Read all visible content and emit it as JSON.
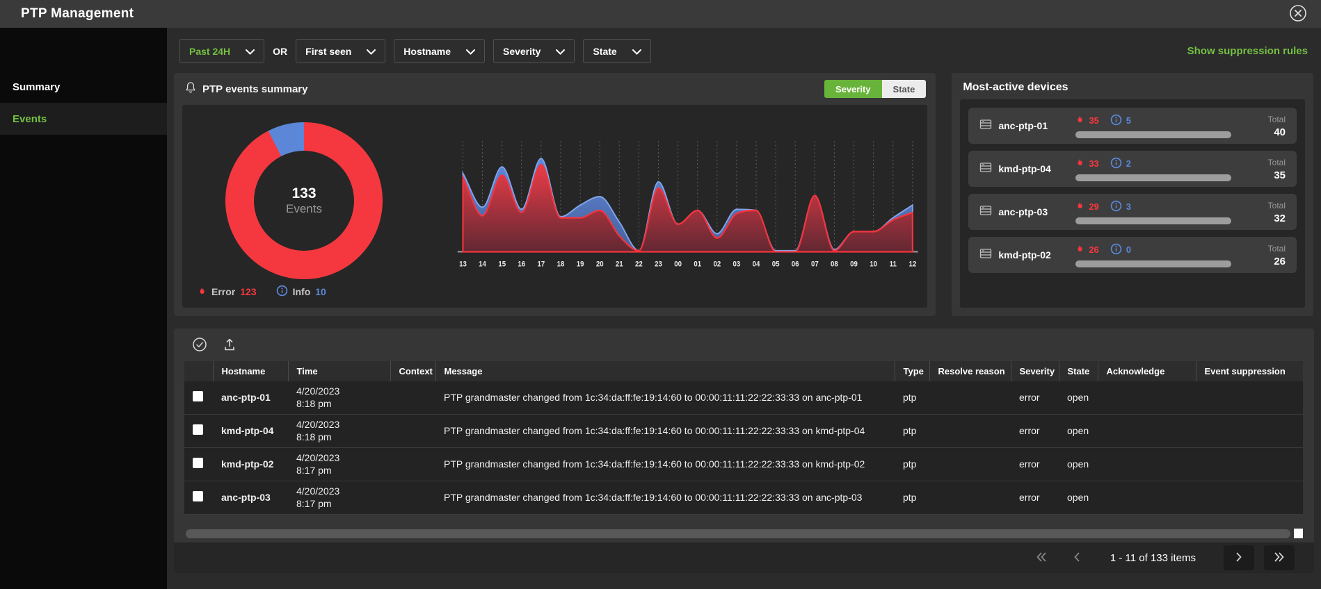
{
  "colors": {
    "accent_green": "#74c043",
    "error_red": "#f5383f",
    "info_blue": "#5c87d8",
    "device_bar_gray": "#9d9d9d"
  },
  "window": {
    "title": "PTP Management"
  },
  "sidebar": {
    "items": [
      {
        "label": "Summary",
        "active": false
      },
      {
        "label": "Events",
        "active": true
      }
    ]
  },
  "filter_bar": {
    "time_range": "Past 24H",
    "or_label": "OR",
    "dropdowns": [
      "First seen",
      "Hostname",
      "Severity",
      "State"
    ],
    "suppression_link": "Show suppression rules"
  },
  "summary_panel": {
    "title": "PTP events summary",
    "toggle": {
      "options": [
        "Severity",
        "State"
      ],
      "active": "Severity"
    },
    "donut_center": {
      "value": "133",
      "label": "Events"
    },
    "legend": [
      {
        "label": "Error",
        "value": "123",
        "icon": "flame-icon",
        "color": "#f5383f"
      },
      {
        "label": "Info",
        "value": "10",
        "icon": "info-icon",
        "color": "#5c87d8"
      }
    ]
  },
  "chart_data": [
    {
      "type": "pie",
      "donut": true,
      "title": "PTP events by severity",
      "labels": [
        "Error",
        "Info"
      ],
      "values": [
        123,
        10
      ],
      "colors": [
        "#f5383f",
        "#5c87d8"
      ],
      "center_text": "133 Events",
      "legend_position": "bottom-left"
    },
    {
      "type": "area",
      "stacked": true,
      "title": "PTP events over time by severity",
      "x": [
        "13",
        "14",
        "15",
        "16",
        "17",
        "18",
        "19",
        "20",
        "21",
        "22",
        "23",
        "00",
        "01",
        "02",
        "03",
        "04",
        "05",
        "06",
        "07",
        "08",
        "09",
        "10",
        "11",
        "12"
      ],
      "series": [
        {
          "name": "Error",
          "color": "#f5383f",
          "values": [
            70,
            34,
            72,
            37,
            82,
            32,
            32,
            39,
            15,
            1,
            60,
            26,
            39,
            13,
            36,
            39,
            0,
            0,
            53,
            1,
            19,
            19,
            30,
            37
          ]
        },
        {
          "name": "Info",
          "color": "#5c87d8",
          "values": [
            4,
            8,
            8,
            3,
            6,
            1,
            12,
            13,
            13,
            0,
            6,
            0,
            0,
            4,
            4,
            0,
            1,
            1,
            0,
            1,
            0,
            0,
            2,
            7
          ]
        }
      ],
      "ylim": [
        0,
        100
      ],
      "grid": "vertical-dotted"
    }
  ],
  "devices_panel": {
    "title": "Most-active devices",
    "total_label": "Total",
    "devices": [
      {
        "name": "anc-ptp-01",
        "error": "35",
        "info": "5",
        "total": "40"
      },
      {
        "name": "kmd-ptp-04",
        "error": "33",
        "info": "2",
        "total": "35"
      },
      {
        "name": "anc-ptp-03",
        "error": "29",
        "info": "3",
        "total": "32"
      },
      {
        "name": "kmd-ptp-02",
        "error": "26",
        "info": "0",
        "total": "26"
      }
    ]
  },
  "events_table": {
    "columns": [
      "Hostname",
      "Time",
      "Context",
      "Message",
      "Type",
      "Resolve reason",
      "Severity",
      "State",
      "Acknowledge",
      "Event suppression"
    ],
    "rows": [
      {
        "selected": true,
        "hostname": "anc-ptp-01",
        "time": "4/20/2023 8:18 pm",
        "context": "",
        "message": "PTP grandmaster changed from 1c:34:da:ff:fe:19:14:60 to 00:00:11:11:22:22:33:33 on anc-ptp-01",
        "type": "ptp",
        "resolve_reason": "",
        "severity": "error",
        "state": "open",
        "acknowledge": "",
        "event_suppression": ""
      },
      {
        "selected": true,
        "hostname": "kmd-ptp-04",
        "time": "4/20/2023 8:18 pm",
        "context": "",
        "message": "PTP grandmaster changed from 1c:34:da:ff:fe:19:14:60 to 00:00:11:11:22:22:33:33 on kmd-ptp-04",
        "type": "ptp",
        "resolve_reason": "",
        "severity": "error",
        "state": "open",
        "acknowledge": "",
        "event_suppression": ""
      },
      {
        "selected": true,
        "hostname": "kmd-ptp-02",
        "time": "4/20/2023 8:17 pm",
        "context": "",
        "message": "PTP grandmaster changed from 1c:34:da:ff:fe:19:14:60 to 00:00:11:11:22:22:33:33 on kmd-ptp-02",
        "type": "ptp",
        "resolve_reason": "",
        "severity": "error",
        "state": "open",
        "acknowledge": "",
        "event_suppression": ""
      },
      {
        "selected": true,
        "hostname": "anc-ptp-03",
        "time": "4/20/2023 8:17 pm",
        "context": "",
        "message": "PTP grandmaster changed from 1c:34:da:ff:fe:19:14:60 to 00:00:11:11:22:22:33:33 on anc-ptp-03",
        "type": "ptp",
        "resolve_reason": "",
        "severity": "error",
        "state": "open",
        "acknowledge": "",
        "event_suppression": ""
      }
    ],
    "pagination": {
      "label": "1 - 11 of 133 items"
    }
  }
}
